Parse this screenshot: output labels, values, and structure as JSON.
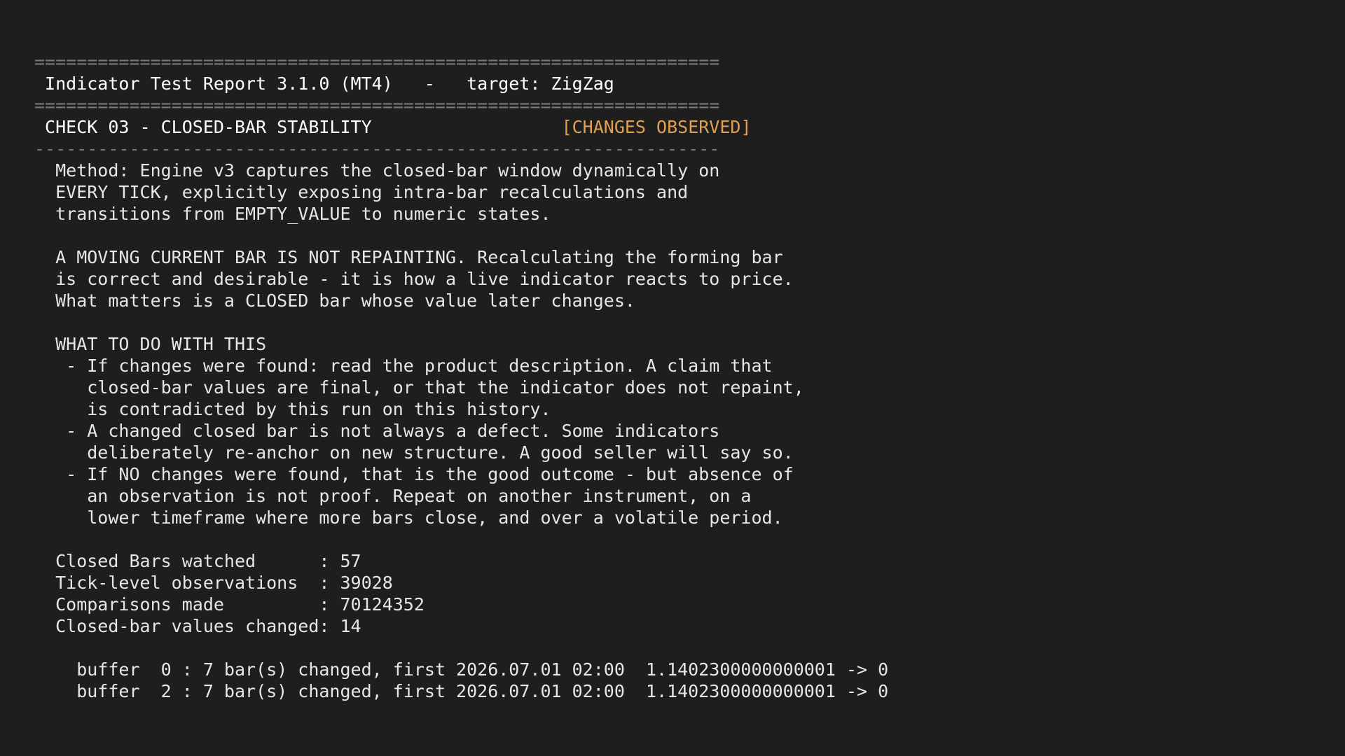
{
  "report": {
    "rule_double": "=================================================================",
    "title_line": " Indicator Test Report 3.1.0 (MT4)   -   target: ZigZag",
    "rule_single": "-----------------------------------------------------------------"
  },
  "check": {
    "heading": " CHECK 03 - CLOSED-BAR STABILITY                  ",
    "status": "[CHANGES OBSERVED]",
    "status_color": "#e0a050"
  },
  "method": [
    "  Method: Engine v3 captures the closed-bar window dynamically on",
    "  EVERY TICK, explicitly exposing intra-bar recalculations and",
    "  transitions from EMPTY_VALUE to numeric states."
  ],
  "repaint_note": [
    "  A MOVING CURRENT BAR IS NOT REPAINTING. Recalculating the forming bar",
    "  is correct and desirable - it is how a live indicator reacts to price.",
    "  What matters is a CLOSED bar whose value later changes."
  ],
  "guidance": {
    "heading": "  WHAT TO DO WITH THIS",
    "items": [
      "   - If changes were found: read the product description. A claim that",
      "     closed-bar values are final, or that the indicator does not repaint,",
      "     is contradicted by this run on this history.",
      "   - A changed closed bar is not always a defect. Some indicators",
      "     deliberately re-anchor on new structure. A good seller will say so.",
      "   - If NO changes were found, that is the good outcome - but absence of",
      "     an observation is not proof. Repeat on another instrument, on a",
      "     lower timeframe where more bars close, and over a volatile period."
    ]
  },
  "stats": [
    "  Closed Bars watched      : 57",
    "  Tick-level observations  : 39028",
    "  Comparisons made         : 70124352",
    "  Closed-bar values changed: 14"
  ],
  "buffers": [
    "    buffer  0 : 7 bar(s) changed, first 2026.07.01 02:00  1.1402300000000001 -> 0",
    "    buffer  2 : 7 bar(s) changed, first 2026.07.01 02:00  1.1402300000000001 -> 0"
  ],
  "colors": {
    "background": "#1e1e1e",
    "text": "#e6e6e6",
    "rule": "#7a7a7a",
    "status": "#e0a050"
  }
}
